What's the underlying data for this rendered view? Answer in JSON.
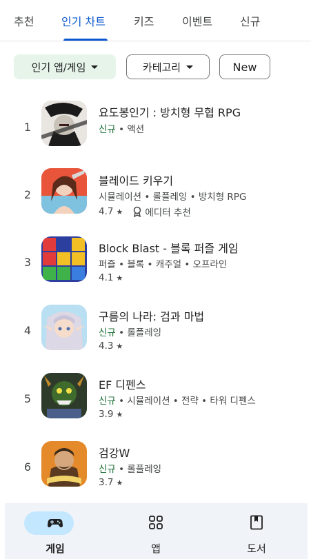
{
  "tabs": [
    {
      "label": "추천"
    },
    {
      "label": "인기 차트"
    },
    {
      "label": "키즈"
    },
    {
      "label": "이벤트"
    },
    {
      "label": "신규"
    }
  ],
  "active_tab": "인기 차트",
  "chips": {
    "chart_type": "인기 앱/게임",
    "category": "카테고리",
    "new": "New"
  },
  "apps": [
    {
      "rank": "1",
      "title": "요도봉인기 : 방치형 무협 RPG",
      "new_badge": "신규",
      "tags": "액션",
      "rating": "",
      "icon": "swordsman-portrait-icon"
    },
    {
      "rank": "2",
      "title": "블레이드 키우기",
      "new_badge": "",
      "tags": "시뮬레이션 • 롤플레잉 • 방치형 RPG",
      "rating": "4.7",
      "editor": "에디터 추천",
      "icon": "blade-heroine-icon"
    },
    {
      "rank": "3",
      "title": "Block Blast - 블록 퍼즐 게임",
      "new_badge": "",
      "tags": "퍼즐 • 블록 • 캐주얼 • 오프라인",
      "rating": "4.1",
      "icon": "color-blocks-icon"
    },
    {
      "rank": "4",
      "title": "구름의 나라: 검과 마법",
      "new_badge": "신규",
      "tags": "롤플레잉",
      "rating": "4.3",
      "icon": "elf-girl-icon"
    },
    {
      "rank": "5",
      "title": "EF 디펜스",
      "new_badge": "신규",
      "tags": "시뮬레이션 • 전략 • 타워 디펜스",
      "rating": "3.9",
      "icon": "monster-defense-icon"
    },
    {
      "rank": "6",
      "title": "검강W",
      "new_badge": "신규",
      "tags": "롤플레잉",
      "rating": "3.7",
      "icon": "warrior-portrait-icon"
    }
  ],
  "bottom_nav": [
    {
      "label": "게임",
      "icon": "gamepad-icon",
      "active": true
    },
    {
      "label": "앱",
      "icon": "apps-grid-icon",
      "active": false
    },
    {
      "label": "도서",
      "icon": "bookmark-book-icon",
      "active": false
    }
  ],
  "colors": {
    "accent": "#0b57d0",
    "new_badge": "#146c2e",
    "selected_chip": "#e6f4ea",
    "nav_pill": "#c2e7ff",
    "nav_bg": "#f0f4f9"
  }
}
